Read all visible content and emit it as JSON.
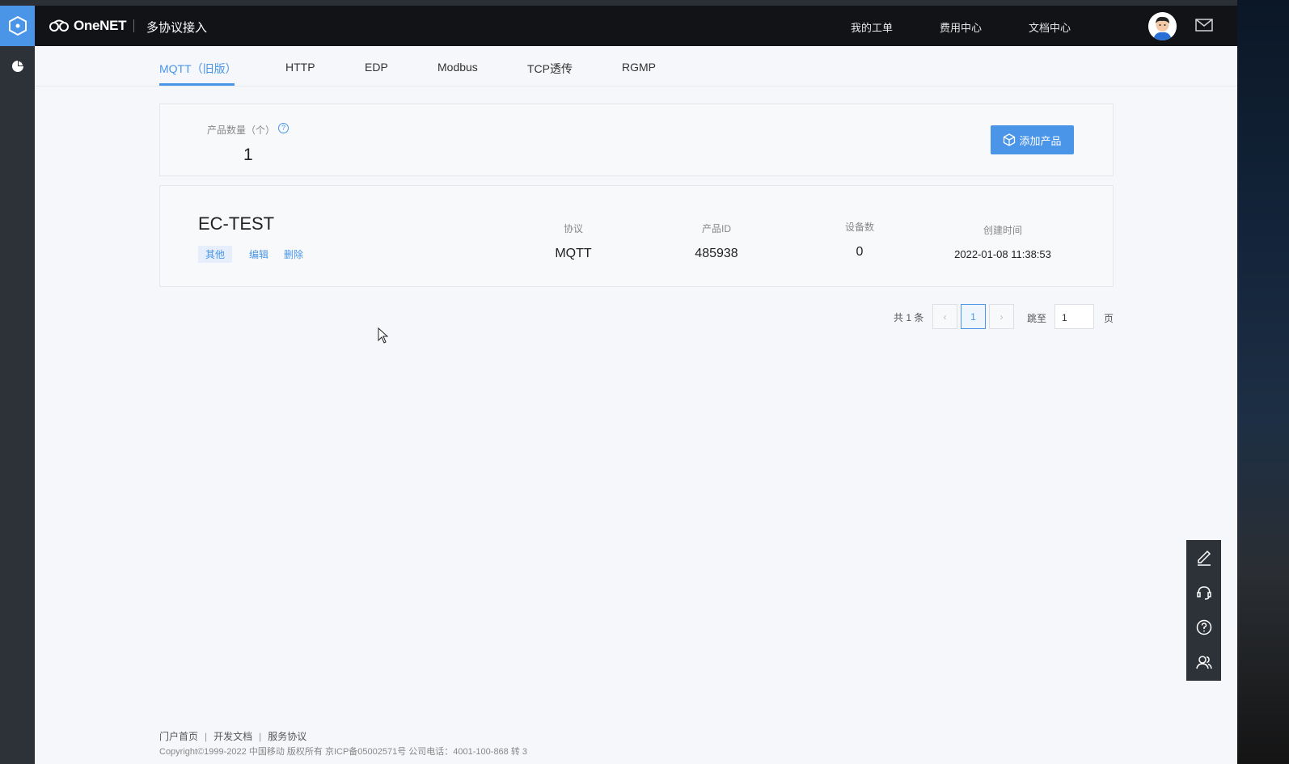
{
  "header": {
    "brand": "OneNET",
    "title": "多协议接入",
    "nav": [
      "我的工单",
      "费用中心",
      "文档中心"
    ]
  },
  "tabs": [
    "MQTT（旧版）",
    "HTTP",
    "EDP",
    "Modbus",
    "TCP透传",
    "RGMP"
  ],
  "summary": {
    "label": "产品数量（个）",
    "count": "1",
    "add_button": "添加产品"
  },
  "product": {
    "name": "EC-TEST",
    "tag": "其他",
    "actions": [
      "编辑",
      "删除"
    ],
    "columns": [
      {
        "header": "协议",
        "value": "MQTT"
      },
      {
        "header": "产品ID",
        "value": "485938"
      },
      {
        "header": "设备数",
        "value": "0"
      },
      {
        "header": "创建时间",
        "value": "2022-01-08 11:38:53"
      }
    ]
  },
  "pagination": {
    "total": "共 1 条",
    "prev": "‹",
    "current": "1",
    "next": "›",
    "jump_label": "跳至",
    "jump_value": "1",
    "page_suffix": "页"
  },
  "footer": {
    "links": [
      "门户首页",
      "开发文档",
      "服务协议"
    ],
    "copyright": "Copyright©1999-2022 中国移动 版权所有 京ICP备05002571号 公司电话：4001-100-868 转 3"
  },
  "colors": {
    "accent": "#4a95e8",
    "header_bg": "#111317",
    "rail_bg": "#2d3239"
  }
}
